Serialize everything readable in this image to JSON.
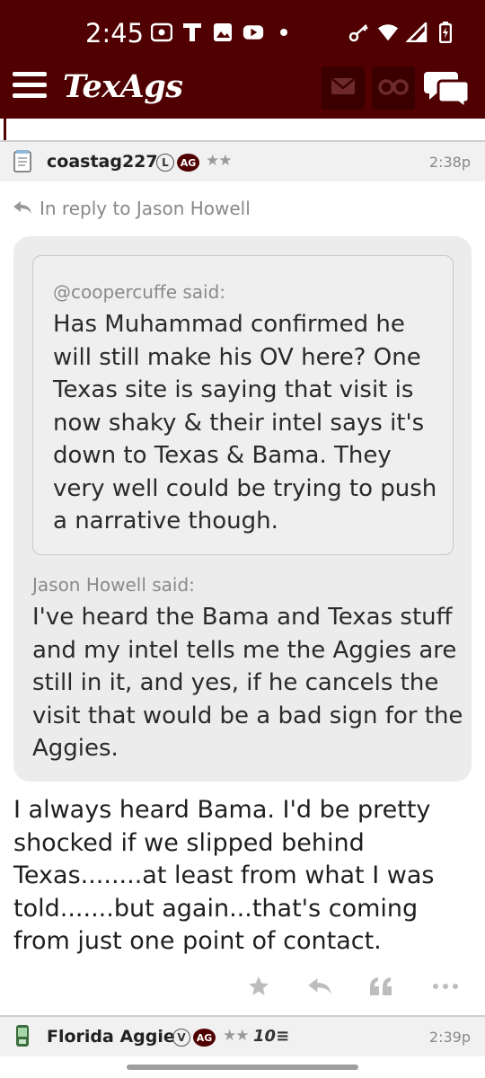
{
  "status_bar": {
    "time": "2:45",
    "icons_left": [
      "radio-icon",
      "t-icon",
      "image-icon",
      "youtube-icon",
      "dot-icon"
    ],
    "icons_right": [
      "key-icon",
      "wifi-icon",
      "signal-icon",
      "battery-icon"
    ]
  },
  "app_bar": {
    "logo": "TexAgs",
    "bg_color": "#500000"
  },
  "post": {
    "username": "coastag227",
    "badge_l": "L",
    "badge_ag": "AG",
    "stars": "★★",
    "time": "2:38p",
    "reply_to": "In reply to Jason Howell",
    "inner_quote": {
      "said": "@coopercuffe said:",
      "text": "Has Muhammad confirmed he will still make his OV here? One Texas site is saying that visit is now shaky & their intel says it's down to Texas & Bama. They very well could be trying to push a narrative though."
    },
    "outer_quote": {
      "said": "Jason Howell said:",
      "text": "I've heard the Bama and Texas stuff and my intel tells me the Aggies are still in it, and yes, if he cancels the visit that would be a bad sign for the Aggies."
    },
    "body": "I always heard Bama. I'd be pretty shocked if we slipped behind Texas........at least from what I was told.......but again...that's coming from just one point of contact."
  },
  "next_post": {
    "username": "Florida Aggie",
    "badge_v": "V",
    "badge_ag": "AG",
    "stars": "★★",
    "ten": "10",
    "time": "2:39p"
  }
}
